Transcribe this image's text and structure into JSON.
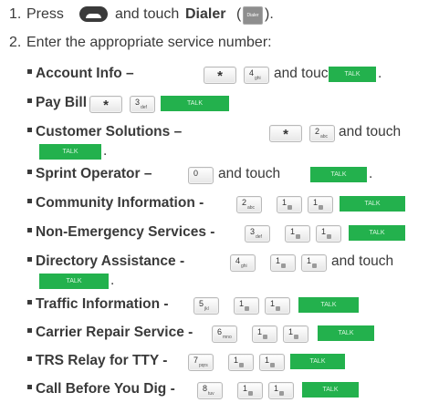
{
  "step1": {
    "num": "1.",
    "press": "Press",
    "and_touch": "and touch",
    "dialer": "Dialer",
    "open_paren": "(",
    "close_paren": ").",
    "dialer_icon_label": "Dialer"
  },
  "step2": {
    "num": "2.",
    "text": "Enter the appropriate service number:"
  },
  "talk_label": "TALK",
  "items": [
    {
      "title": "Account Info",
      "sep": "–",
      "keys": [
        "*",
        "4"
      ],
      "suffix": "and touch",
      "end": "."
    },
    {
      "title": "Pay Bill",
      "sep": "-",
      "keys": [
        "*",
        "3"
      ]
    },
    {
      "title": "Customer Solutions",
      "sep": "–",
      "keys": [
        "*",
        "2"
      ],
      "suffix": "and touch",
      "end": "."
    },
    {
      "title": "Sprint Operator",
      "sep": "–",
      "keys": [
        "0"
      ],
      "suffix": "and touch",
      "end": "."
    },
    {
      "title": "Community Information",
      "sep": "-",
      "keys": [
        "2",
        "1",
        "1"
      ]
    },
    {
      "title": "Non-Emergency Services",
      "sep": "-",
      "keys": [
        "3",
        "1",
        "1"
      ]
    },
    {
      "title": "Directory Assistance",
      "sep": "-",
      "keys": [
        "4",
        "1",
        "1"
      ],
      "suffix": "and touch",
      "end": "."
    },
    {
      "title": "Traffic Information",
      "sep": "-",
      "keys": [
        "5",
        "1",
        "1"
      ]
    },
    {
      "title": "Carrier Repair Service",
      "sep": "-",
      "keys": [
        "6",
        "1",
        "1"
      ]
    },
    {
      "title": "TRS Relay for TTY",
      "sep": "-",
      "keys": [
        "7",
        "1",
        "1"
      ]
    },
    {
      "title": "Call Before You Dig",
      "sep": "-",
      "keys": [
        "8",
        "1",
        "1"
      ]
    }
  ],
  "key_subs": {
    "2": "abc",
    "3": "def",
    "4": "ghi",
    "5": "jkl",
    "6": "mno",
    "7": "pqrs",
    "8": "tuv"
  },
  "colors": {
    "talk": "#23b14d",
    "text": "#3a3a3a"
  }
}
